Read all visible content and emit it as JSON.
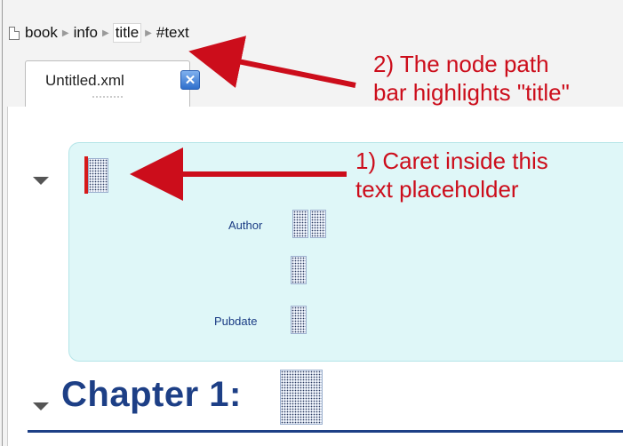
{
  "breadcrumb": {
    "items": [
      "book",
      "info",
      "title",
      "#text"
    ],
    "active": "title"
  },
  "tab": {
    "label": "Untitled.xml",
    "close_glyph": "✕"
  },
  "editor": {
    "field_labels": {
      "author": "Author",
      "pubdate": "Pubdate"
    },
    "chapter_heading": "Chapter 1:"
  },
  "annotations": {
    "note1_line1": "1) Caret inside this",
    "note1_line2": "text placeholder",
    "note2_line1": "2) The node path",
    "note2_line2": "bar highlights \"title\""
  },
  "colors": {
    "annotation": "#cc0d1b",
    "accent": "#1d3f86",
    "info_bg": "#dff7f8"
  },
  "icons": [
    "document-icon",
    "close-icon",
    "collapse-triangle-icon"
  ]
}
